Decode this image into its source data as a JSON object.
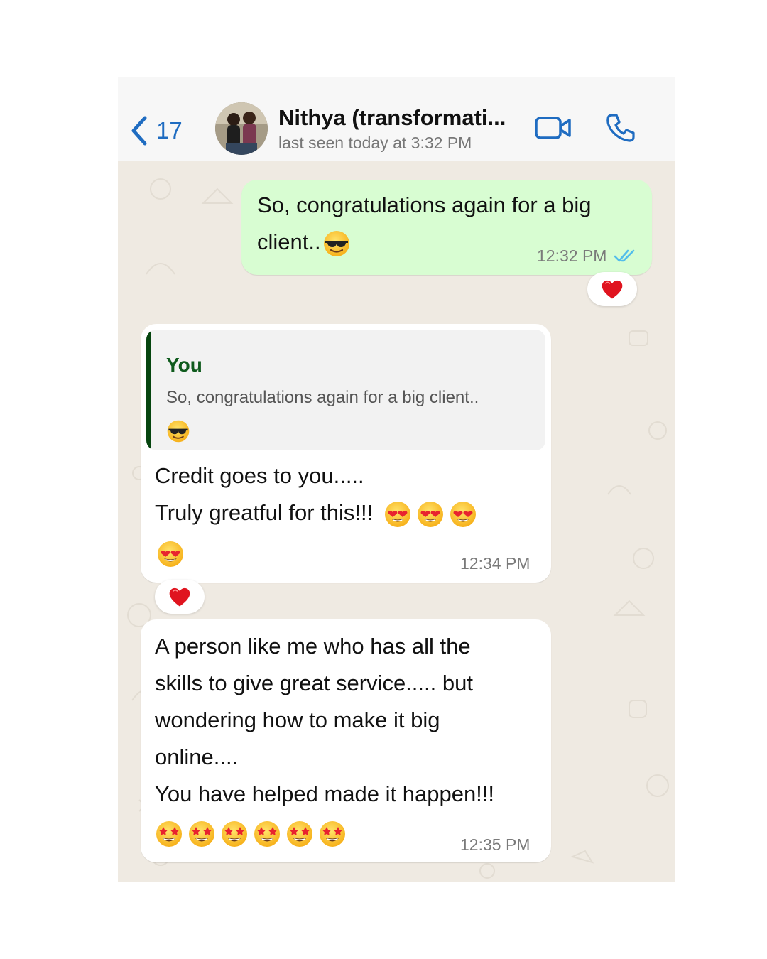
{
  "header": {
    "back_count": "17",
    "contact_name": "Nithya (transformati...",
    "status": "last seen today at 3:32 PM"
  },
  "messages": [
    {
      "direction": "outgoing",
      "lines": [
        "So, congratulations again for a big",
        "client.."
      ],
      "emoji": [
        "smiling-face-with-sunglasses"
      ],
      "time": "12:32 PM",
      "read_receipt": "double-check-blue",
      "reaction": "red-heart"
    },
    {
      "direction": "incoming",
      "quote": {
        "author": "You",
        "text": "So, congratulations again for a big client..",
        "emoji": [
          "smiling-face-with-sunglasses"
        ]
      },
      "lines": [
        "Credit goes to you.....",
        "Truly greatful for this!!!"
      ],
      "emoji": [
        "smiling-face-with-heart-eyes",
        "smiling-face-with-heart-eyes",
        "smiling-face-with-heart-eyes",
        "smiling-face-with-heart-eyes"
      ],
      "time": "12:34 PM",
      "reaction": "red-heart"
    },
    {
      "direction": "incoming",
      "lines": [
        "A person like me who has all the",
        "skills to give great service..... but",
        "wondering how to make it big",
        "online....",
        "You have helped made it happen!!!"
      ],
      "emoji": [
        "star-struck",
        "star-struck",
        "star-struck",
        "star-struck",
        "star-struck",
        "star-struck"
      ],
      "time": "12:35 PM"
    }
  ],
  "colors": {
    "outgoing_bubble": "#d8fdd2",
    "incoming_bubble": "#ffffff",
    "chat_background": "#efeae2",
    "accent_blue": "#1f6cc1",
    "quote_accent": "#06450f",
    "read_receipt": "#53bdeb"
  }
}
